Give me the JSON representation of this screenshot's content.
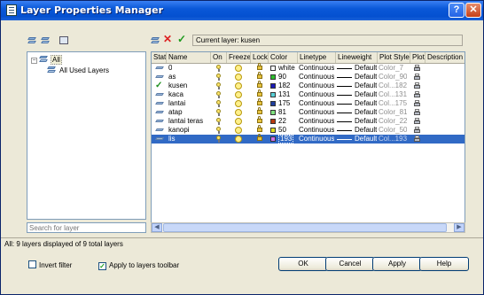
{
  "window": {
    "title": "Layer Properties Manager",
    "help_label": "?",
    "close_label": "✕"
  },
  "toolbar": {
    "left_icons": [
      "new-filter-icon",
      "new-group-filter-icon",
      "state-manager-icon"
    ],
    "right_icons": [
      "new-layer-icon",
      "delete-layer-icon",
      "set-current-icon"
    ],
    "current_layer_label": "Current layer: kusen"
  },
  "tree": {
    "root_label": "All",
    "child_label": "All Used Layers",
    "expander": "⊟"
  },
  "search": {
    "placeholder": "Search for layer"
  },
  "columns": [
    "Stat",
    "Name",
    "On",
    "Freeze",
    "Lock",
    "Color",
    "Linetype",
    "Lineweight",
    "Plot Style",
    "Plot",
    "Description"
  ],
  "layers": [
    {
      "status": "layer",
      "name": "0",
      "color_name": "white",
      "color_hex": "#ffffff",
      "linetype": "Continuous",
      "lineweight": "Default",
      "plot_style": "Color_7"
    },
    {
      "status": "layer",
      "name": "as",
      "color_name": "90",
      "color_hex": "#2fbf2f",
      "linetype": "Continuous",
      "lineweight": "Default",
      "plot_style": "Color_90"
    },
    {
      "status": "current",
      "name": "kusen",
      "color_name": "182",
      "color_hex": "#1a1ab8",
      "linetype": "Continuous",
      "lineweight": "Default",
      "plot_style": "Col...182"
    },
    {
      "status": "layer",
      "name": "kaca",
      "color_name": "131",
      "color_hex": "#58d0d8",
      "linetype": "Continuous",
      "lineweight": "Default",
      "plot_style": "Col...131"
    },
    {
      "status": "layer",
      "name": "lantai",
      "color_name": "175",
      "color_hex": "#1f3f9f",
      "linetype": "Continuous",
      "lineweight": "Default",
      "plot_style": "Col...175"
    },
    {
      "status": "layer",
      "name": "atap",
      "color_name": "81",
      "color_hex": "#7fe07f",
      "linetype": "Continuous",
      "lineweight": "Default",
      "plot_style": "Color_81"
    },
    {
      "status": "layer",
      "name": "lantai teras",
      "color_name": "22",
      "color_hex": "#b83a10",
      "linetype": "Continuous",
      "lineweight": "Default",
      "plot_style": "Color_22"
    },
    {
      "status": "layer",
      "name": "kanopi",
      "color_name": "50",
      "color_hex": "#e0e020",
      "linetype": "Continuous",
      "lineweight": "Default",
      "plot_style": "Color_50"
    },
    {
      "status": "layer",
      "name": "lis",
      "color_name": "193",
      "color_hex": "#d070e8",
      "linetype": "Continuous",
      "lineweight": "Default",
      "plot_style": "Col...193",
      "selected": true
    }
  ],
  "status_bar": {
    "text": "All: 9 layers displayed of 9 total layers"
  },
  "footer": {
    "invert_filter_label": "Invert filter",
    "apply_toolbar_label": "Apply to layers toolbar",
    "ok_label": "OK",
    "cancel_label": "Cancel",
    "apply_label": "Apply",
    "help_label": "Help"
  },
  "colors": {
    "selection": "#316ac5",
    "titlebar": "#0a58d8",
    "face": "#ece9d8"
  }
}
